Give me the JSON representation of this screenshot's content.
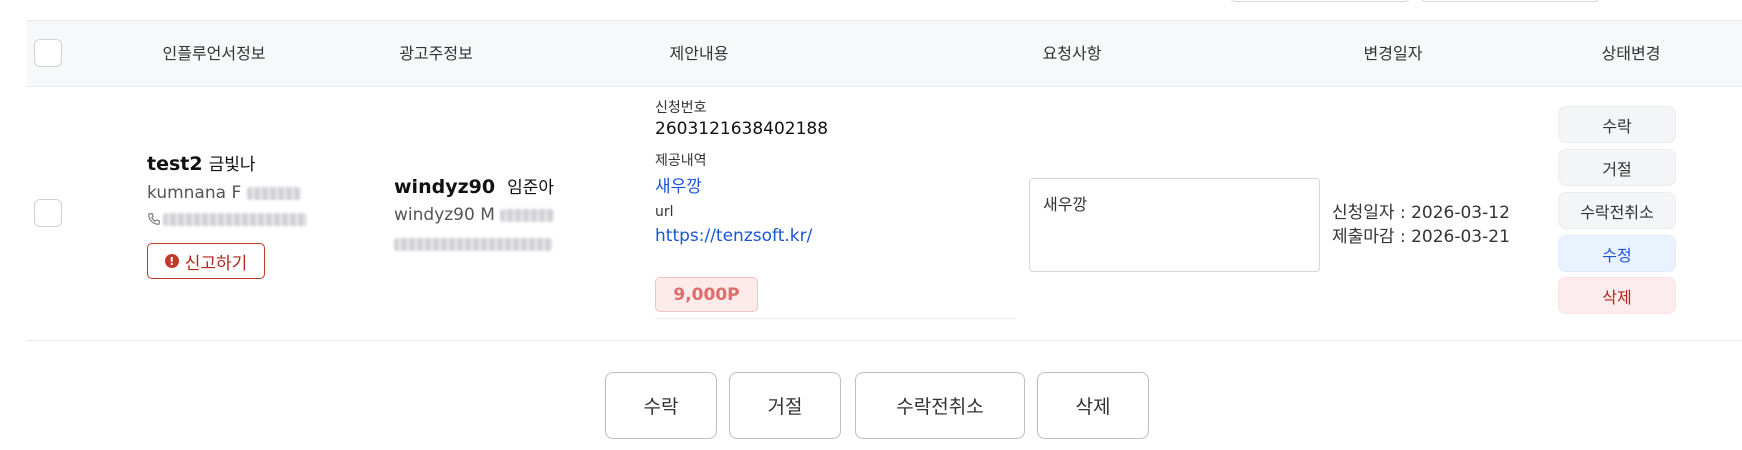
{
  "header": {
    "influencer": "인플루언서정보",
    "advertiser": "광고주정보",
    "proposal": "제안내용",
    "request": "요청사항",
    "changed": "변경일자",
    "status": "상태변경"
  },
  "row": {
    "influencer": {
      "id": "test2",
      "name": "금빛나",
      "username": "kumnana",
      "gender": "F",
      "report_label": "신고하기"
    },
    "advertiser": {
      "id": "windyz90",
      "name": "임준아",
      "username": "windyz90",
      "gender": "M"
    },
    "proposal": {
      "request_no_label": "신청번호",
      "request_no": "2603121638402188",
      "offer_label": "제공내역",
      "offer": "새우깡",
      "url_label": "url",
      "url": "https://tenzsoft.kr/",
      "price": "9,000P"
    },
    "request_memo": "새우깡",
    "dates": {
      "applied": "신청일자 : 2026-03-12",
      "deadline": "제출마감 : 2026-03-21"
    },
    "status_buttons": {
      "accept": "수락",
      "reject": "거절",
      "cancel_accept": "수락전취소",
      "edit": "수정",
      "delete": "삭제"
    }
  },
  "bulk": {
    "accept": "수락",
    "reject": "거절",
    "cancel_accept": "수락전취소",
    "delete": "삭제"
  },
  "colors": {
    "link": "#1a56d6",
    "danger": "#b3261e",
    "price_bg": "#fdeaea",
    "edit_bg": "#eaf2ff"
  }
}
